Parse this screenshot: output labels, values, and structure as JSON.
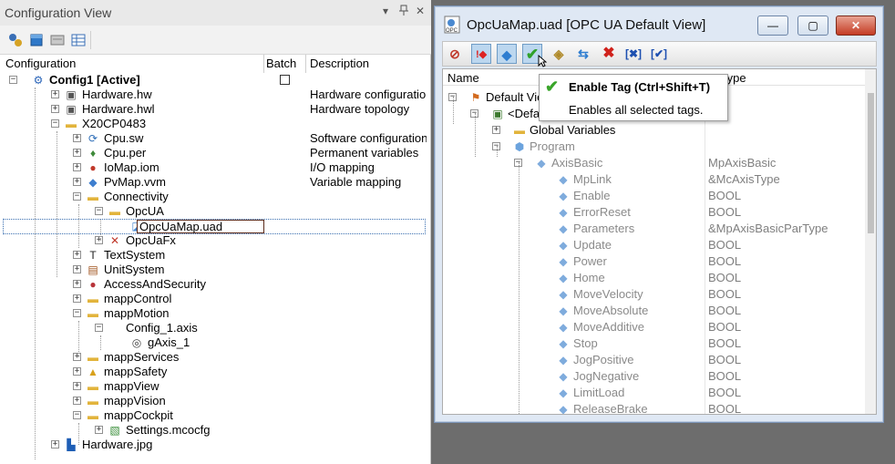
{
  "config_view": {
    "title": "Configuration View",
    "title_controls": [
      "▾",
      "✕"
    ],
    "toolbar_icons": [
      "configuration-icon",
      "cube-icon",
      "hardware-icon",
      "table-icon"
    ],
    "columns": {
      "configuration": "Configuration",
      "batch": "Batch",
      "description": "Description"
    },
    "tree": [
      {
        "label": "Config1 [Active]",
        "icon": "config-gear-icon",
        "exp": "−",
        "bold": true
      },
      {
        "label": "Hardware.hw",
        "icon": "hardware-icon",
        "exp": "+",
        "description": "Hardware configuration"
      },
      {
        "label": "Hardware.hwl",
        "icon": "hardware-icon",
        "exp": "+",
        "description": "Hardware topology"
      },
      {
        "label": "X20CP0483",
        "icon": "folder-icon",
        "exp": "−"
      },
      {
        "label": "Cpu.sw",
        "icon": "software-icon",
        "exp": "+",
        "description": "Software configuration"
      },
      {
        "label": "Cpu.per",
        "icon": "variables-icon",
        "exp": "+",
        "description": "Permanent variables"
      },
      {
        "label": "IoMap.iom",
        "icon": "io-mapping-icon",
        "exp": "+",
        "description": "I/O mapping"
      },
      {
        "label": "PvMap.vvm",
        "icon": "variable-mapping-icon",
        "exp": "+",
        "description": "Variable mapping"
      },
      {
        "label": "Connectivity",
        "icon": "folder-icon",
        "exp": "−"
      },
      {
        "label": "OpcUA",
        "icon": "folder-icon",
        "exp": "−"
      },
      {
        "label": "OpcUaMap.uad",
        "icon": "opcua-map-icon",
        "editing": true
      },
      {
        "label": "OpcUaFx",
        "icon": "disabled-x-icon",
        "exp": "+"
      },
      {
        "label": "TextSystem",
        "icon": "text-icon",
        "exp": "+"
      },
      {
        "label": "UnitSystem",
        "icon": "unit-icon",
        "exp": "+"
      },
      {
        "label": "AccessAndSecurity",
        "icon": "security-icon",
        "exp": "+"
      },
      {
        "label": "mappControl",
        "icon": "folder-icon",
        "exp": "+"
      },
      {
        "label": "mappMotion",
        "icon": "folder-icon",
        "exp": "−"
      },
      {
        "label": "Config_1.axis",
        "icon": "",
        "exp": "−"
      },
      {
        "label": "gAxis_1",
        "icon": "axis-icon"
      },
      {
        "label": "mappServices",
        "icon": "folder-icon",
        "exp": "+"
      },
      {
        "label": "mappSafety",
        "icon": "safety-icon",
        "exp": "+"
      },
      {
        "label": "mappView",
        "icon": "folder-icon",
        "exp": "+"
      },
      {
        "label": "mappVision",
        "icon": "folder-icon",
        "exp": "+"
      },
      {
        "label": "mappCockpit",
        "icon": "folder-icon",
        "exp": "−"
      },
      {
        "label": "Settings.mcocfg",
        "icon": "settings-file-icon",
        "exp": "+"
      },
      {
        "label": "Hardware.jpg",
        "icon": "image-icon",
        "exp": "+"
      }
    ]
  },
  "opcua_window": {
    "title": "OpcUaMap.uad [OPC UA Default View]",
    "window_controls": {
      "minimize": "—",
      "maximize": "▢",
      "close": "✕"
    },
    "toolbar": [
      {
        "name": "disable-all-icon",
        "glyph": "⊘"
      },
      {
        "name": "enable-tag-exclaim-icon",
        "glyph": "!◆"
      },
      {
        "name": "tag-icon",
        "glyph": "◆"
      },
      {
        "name": "enable-tag-icon",
        "glyph": "✔"
      },
      {
        "name": "cube-arrow-icon",
        "glyph": "◈"
      },
      {
        "name": "refresh-icon",
        "glyph": "⇆"
      },
      {
        "name": "delete-icon",
        "glyph": "✖"
      },
      {
        "name": "remove-tag-icon",
        "glyph": "[✖]"
      },
      {
        "name": "check-tag-icon",
        "glyph": "[✔]"
      }
    ],
    "columns": {
      "name": "Name",
      "datatype": "atatype"
    },
    "tree": [
      {
        "label": "Default View",
        "exp": "−",
        "icon": "flag-icon",
        "dim": false
      },
      {
        "label": "<Default>",
        "exp": "−",
        "icon": "plc-icon",
        "dim": false
      },
      {
        "label": "Global Variables",
        "exp": "+",
        "icon": "folder-icon",
        "dim": false
      },
      {
        "label": "Program",
        "exp": "−",
        "icon": "program-icon",
        "dim": true
      },
      {
        "label": "AxisBasic",
        "exp": "−",
        "icon": "tag-icon",
        "dim": true,
        "datatype": "MpAxisBasic"
      },
      {
        "label": "MpLink",
        "icon": "tag-icon",
        "dim": true,
        "datatype": "&McAxisType"
      },
      {
        "label": "Enable",
        "icon": "tag-icon",
        "dim": true,
        "datatype": "BOOL"
      },
      {
        "label": "ErrorReset",
        "icon": "tag-icon",
        "dim": true,
        "datatype": "BOOL"
      },
      {
        "label": "Parameters",
        "icon": "tag-icon",
        "dim": true,
        "datatype": "&MpAxisBasicParType"
      },
      {
        "label": "Update",
        "icon": "tag-icon",
        "dim": true,
        "datatype": "BOOL"
      },
      {
        "label": "Power",
        "icon": "tag-icon",
        "dim": true,
        "datatype": "BOOL"
      },
      {
        "label": "Home",
        "icon": "tag-icon",
        "dim": true,
        "datatype": "BOOL"
      },
      {
        "label": "MoveVelocity",
        "icon": "tag-icon",
        "dim": true,
        "datatype": "BOOL"
      },
      {
        "label": "MoveAbsolute",
        "icon": "tag-icon",
        "dim": true,
        "datatype": "BOOL"
      },
      {
        "label": "MoveAdditive",
        "icon": "tag-icon",
        "dim": true,
        "datatype": "BOOL"
      },
      {
        "label": "Stop",
        "icon": "tag-icon",
        "dim": true,
        "datatype": "BOOL"
      },
      {
        "label": "JogPositive",
        "icon": "tag-icon",
        "dim": true,
        "datatype": "BOOL"
      },
      {
        "label": "JogNegative",
        "icon": "tag-icon",
        "dim": true,
        "datatype": "BOOL"
      },
      {
        "label": "LimitLoad",
        "icon": "tag-icon",
        "dim": true,
        "datatype": "BOOL"
      },
      {
        "label": "ReleaseBrake",
        "icon": "tag-icon",
        "dim": true,
        "datatype": "BOOL"
      }
    ]
  },
  "tooltip": {
    "title": "Enable Tag (Ctrl+Shift+T)",
    "text": "Enables all selected tags."
  }
}
